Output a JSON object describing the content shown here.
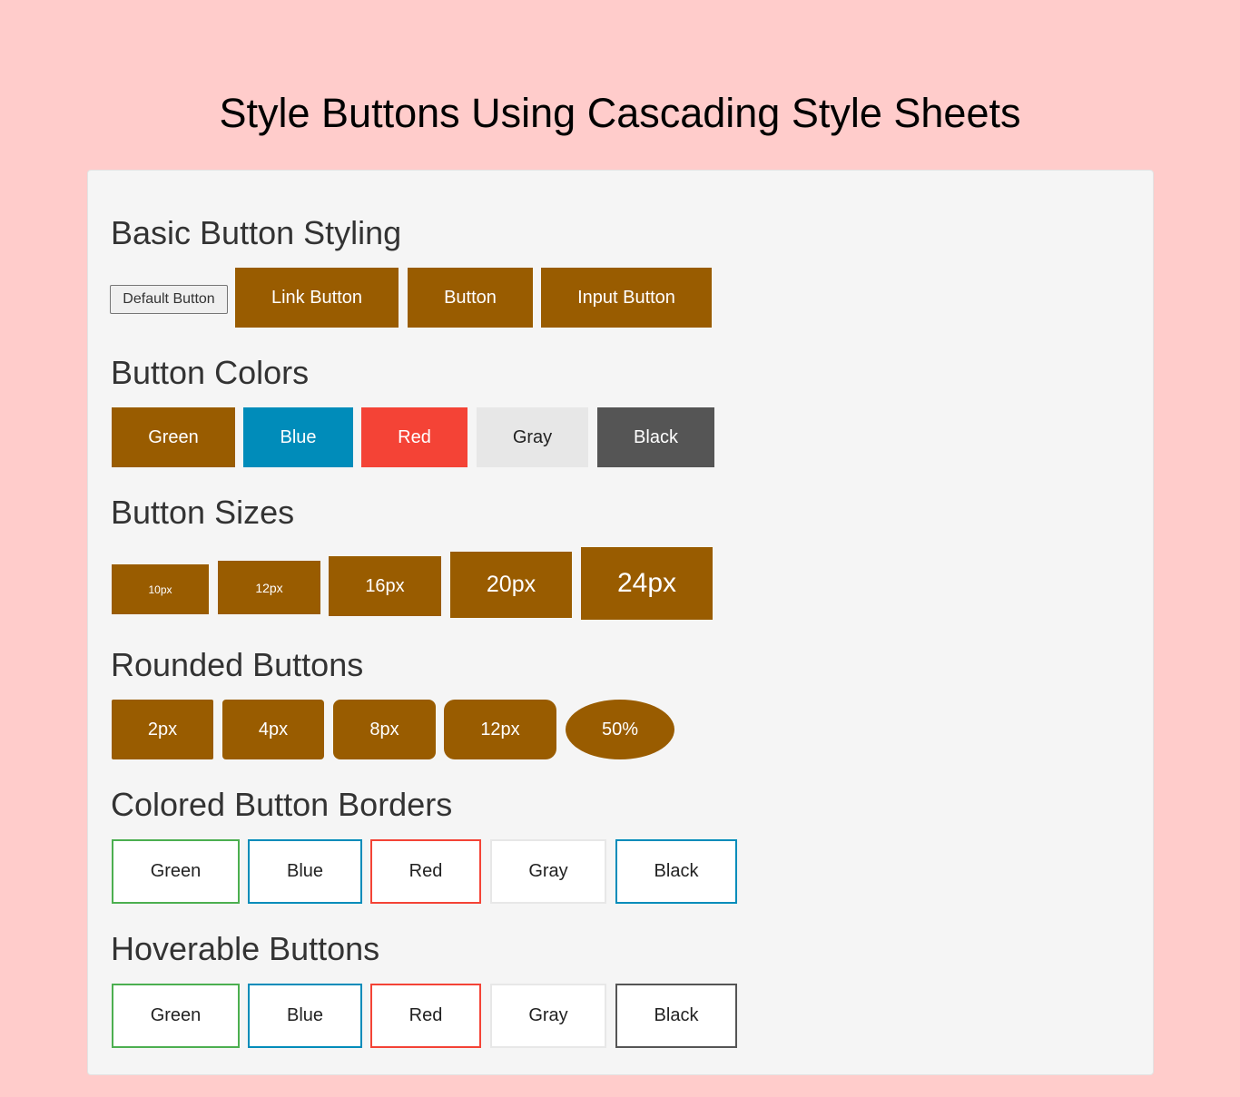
{
  "page": {
    "title": "Style Buttons Using Cascading Style Sheets"
  },
  "colors": {
    "page_background": "#ffcccb",
    "panel_background": "#f5f5f5",
    "brand_brown": "#995c00",
    "blue": "#008cba",
    "red": "#f44336",
    "gray": "#e7e7e7",
    "black": "#555555",
    "green_border": "#4caf50"
  },
  "sections": {
    "basic": {
      "heading": "Basic Button Styling",
      "default_button": "Default Button",
      "link_button": "Link Button",
      "button": "Button",
      "input_button": "Input Button"
    },
    "colors": {
      "heading": "Button Colors",
      "green": "Green",
      "blue": "Blue",
      "red": "Red",
      "gray": "Gray",
      "black": "Black"
    },
    "sizes": {
      "heading": "Button Sizes",
      "s10": "10px",
      "s12": "12px",
      "s16": "16px",
      "s20": "20px",
      "s24": "24px"
    },
    "rounded": {
      "heading": "Rounded Buttons",
      "r2": "2px",
      "r4": "4px",
      "r8": "8px",
      "r12": "12px",
      "r50": "50%"
    },
    "borders": {
      "heading": "Colored Button Borders",
      "green": "Green",
      "blue": "Blue",
      "red": "Red",
      "gray": "Gray",
      "black": "Black"
    },
    "hoverable": {
      "heading": "Hoverable Buttons",
      "green": "Green",
      "blue": "Blue",
      "red": "Red",
      "gray": "Gray",
      "black": "Black"
    }
  }
}
